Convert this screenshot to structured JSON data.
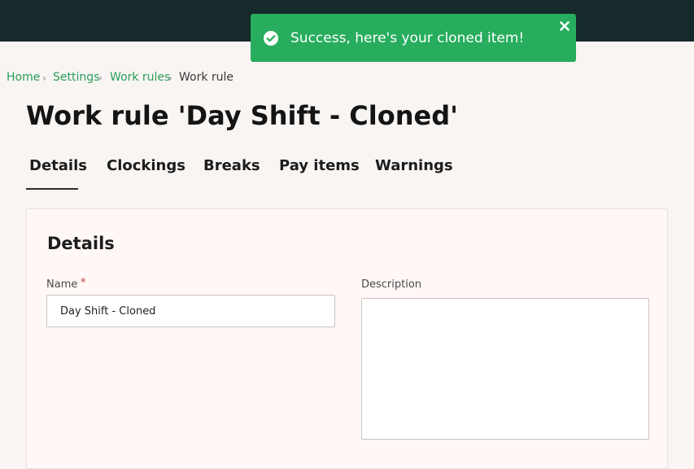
{
  "toast": {
    "message": "Success, here's your cloned item!",
    "icon": "check-circle-icon",
    "close_icon": "close-icon"
  },
  "breadcrumb": {
    "items": [
      {
        "label": "Home"
      },
      {
        "label": "Settings"
      },
      {
        "label": "Work rules"
      },
      {
        "label": "Work rule"
      }
    ],
    "separator": "›"
  },
  "page": {
    "title": "Work rule 'Day Shift - Cloned'"
  },
  "tabs": [
    {
      "label": "Details",
      "active": true
    },
    {
      "label": "Clockings"
    },
    {
      "label": "Breaks"
    },
    {
      "label": "Pay items"
    },
    {
      "label": "Warnings"
    }
  ],
  "details": {
    "heading": "Details",
    "name_label": "Name",
    "required_marker": "*",
    "name_value": "Day Shift - Cloned",
    "description_label": "Description",
    "description_value": ""
  },
  "colors": {
    "topbar": "#162a2c",
    "success": "#27ad5d",
    "link": "#2a9d58",
    "required": "#c93a3a"
  }
}
